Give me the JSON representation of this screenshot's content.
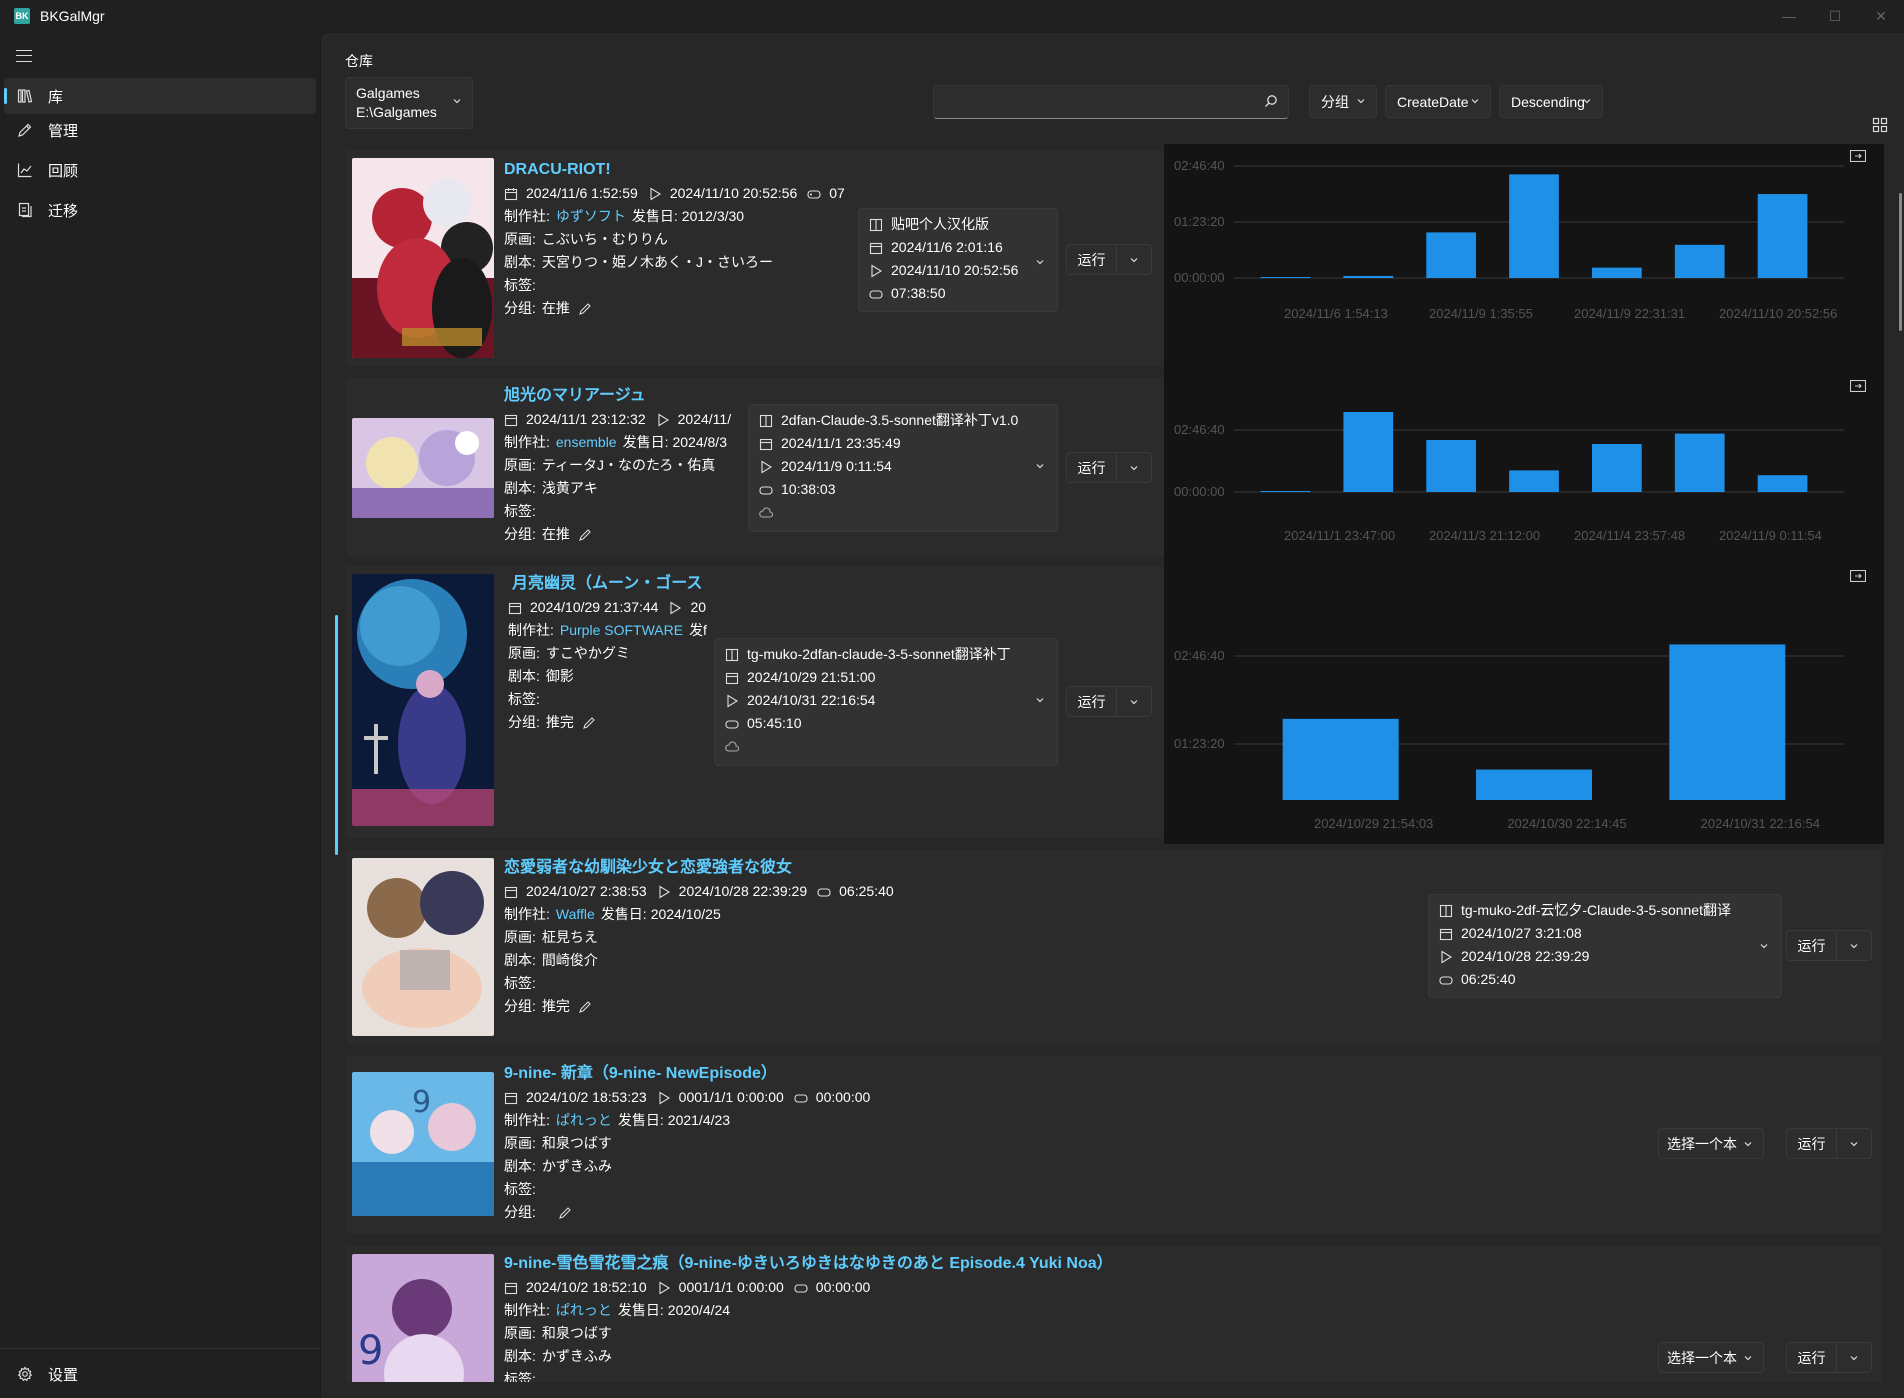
{
  "window": {
    "title": "BKGalMgr",
    "icon_label": "BK"
  },
  "sidebar": {
    "items": [
      {
        "label": "库",
        "icon": "library-icon"
      },
      {
        "label": "管理",
        "icon": "edit-icon"
      },
      {
        "label": "回顾",
        "icon": "chart-icon"
      },
      {
        "label": "迁移",
        "icon": "migrate-icon"
      }
    ],
    "settings_label": "设置"
  },
  "header": {
    "page_title": "仓库",
    "repo_name": "Galgames",
    "repo_path": "E:\\Galgames",
    "search_placeholder": "",
    "group_combo": "分组",
    "sort_combo": "CreateDate",
    "order_combo": "Descending"
  },
  "colors": {
    "accent": "#60cdff",
    "bar": "#1e90e8",
    "card": "#2b2b2b",
    "chart_bg": "#141414"
  },
  "games": [
    {
      "title": "DRACU-RIOT!",
      "created": "2024/11/6 1:52:59",
      "last_played": "2024/11/10 20:52:56",
      "playtime": "07",
      "maker_label": "制作社:",
      "maker": "ゆずソフト",
      "release_label": "发售日:",
      "release": "2012/3/30",
      "artist_label": "原画:",
      "artist": "こぶいち・むりりん",
      "writer_label": "剧本:",
      "writer": "天宮りつ・姫ノ木あく・J・さいろー",
      "tags_label": "标签:",
      "group_label": "分组:",
      "group": "在推",
      "patch": {
        "name": "贴吧个人汉化版",
        "created": "2024/11/6 2:01:16",
        "last_played": "2024/11/10 20:52:56",
        "playtime": "07:38:50"
      },
      "run_label": "运行"
    },
    {
      "title": "旭光のマリアージュ",
      "created": "2024/11/1 23:12:32",
      "last_played": "2024/11/",
      "maker_label": "制作社:",
      "maker": "ensemble",
      "release_label": "发售日:",
      "release": "2024/8/3",
      "artist_label": "原画:",
      "artist": "ティータJ・なのたろ・佑真",
      "writer_label": "剧本:",
      "writer": "浅黄アキ",
      "tags_label": "标签:",
      "group_label": "分组:",
      "group": "在推",
      "patch": {
        "name": "2dfan-Claude-3.5-sonnet翻译补丁v1.0",
        "created": "2024/11/1 23:35:49",
        "last_played": "2024/11/9 0:11:54",
        "playtime": "10:38:03"
      },
      "run_label": "运行"
    },
    {
      "title": "月亮幽灵（ムーン・ゴース",
      "created": "2024/10/29 21:37:44",
      "last_played": "20",
      "maker_label": "制作社:",
      "maker": "Purple SOFTWARE",
      "release_label": "发f",
      "artist_label": "原画:",
      "artist": "すこやかグミ",
      "writer_label": "剧本:",
      "writer": "御影",
      "tags_label": "标签:",
      "group_label": "分组:",
      "group": "推完",
      "patch": {
        "name": "tg-muko-2dfan-claude-3-5-sonnet翻译补丁",
        "created": "2024/10/29 21:51:00",
        "last_played": "2024/10/31 22:16:54",
        "playtime": "05:45:10"
      },
      "run_label": "运行"
    },
    {
      "title": "恋愛弱者な幼馴染少女と恋愛強者な彼女",
      "created": "2024/10/27 2:38:53",
      "last_played": "2024/10/28 22:39:29",
      "playtime": "06:25:40",
      "maker_label": "制作社:",
      "maker": "Waffle",
      "release_label": "发售日:",
      "release": "2024/10/25",
      "artist_label": "原画:",
      "artist": "柾見ちえ",
      "writer_label": "剧本:",
      "writer": "間崎俊介",
      "tags_label": "标签:",
      "group_label": "分组:",
      "group": "推完",
      "patch": {
        "name": "tg-muko-2df-云忆夕-Claude-3-5-sonnet翻译",
        "created": "2024/10/27 3:21:08",
        "last_played": "2024/10/28 22:39:29",
        "playtime": "06:25:40"
      },
      "run_label": "运行"
    },
    {
      "title": "9-nine- 新章（9-nine- NewEpisode）",
      "created": "2024/10/2 18:53:23",
      "last_played": "0001/1/1 0:00:00",
      "playtime": "00:00:00",
      "maker_label": "制作社:",
      "maker": "ぱれっと",
      "release_label": "发售日:",
      "release": "2021/4/23",
      "artist_label": "原画:",
      "artist": "和泉つばす",
      "writer_label": "剧本:",
      "writer": "かずきふみ",
      "tags_label": "标签:",
      "group_label": "分组:",
      "group": "",
      "select_label": "选择一个本",
      "run_label": "运行"
    },
    {
      "title": "9-nine-雪色雪花雪之痕（9-nine-ゆきいろゆきはなゆきのあと Episode.4 Yuki Noa）",
      "created": "2024/10/2 18:52:10",
      "last_played": "0001/1/1 0:00:00",
      "playtime": "00:00:00",
      "maker_label": "制作社:",
      "maker": "ぱれっと",
      "release_label": "发售日:",
      "release": "2020/4/24",
      "artist_label": "原画:",
      "artist": "和泉つばす",
      "writer_label": "剧本:",
      "writer": "かずきふみ",
      "tags_label": "标签:",
      "select_label": "选择一个本",
      "run_label": "运行"
    }
  ],
  "chart_data": [
    {
      "type": "bar",
      "categories": [
        "2024/11/6 1:54:13",
        "2024/11/9 1:35:55",
        "2024/11/9 22:31:31",
        "2024/11/10 20:52:56"
      ],
      "y_ticks": [
        "00:00:00",
        "01:23:20",
        "02:46:40"
      ],
      "values_seconds": [
        60,
        200,
        4400,
        10000,
        1000,
        3200,
        8100
      ],
      "ylim": [
        0,
        11000
      ]
    },
    {
      "type": "bar",
      "categories": [
        "2024/11/1 23:47:00",
        "2024/11/3 21:12:00",
        "2024/11/4 23:57:48",
        "2024/11/9 0:11:54"
      ],
      "y_ticks": [
        "00:00:00",
        "02:46:40"
      ],
      "values_seconds": [
        50,
        10000,
        6500,
        2700,
        6000,
        7300,
        2100
      ],
      "ylim": [
        0,
        12500
      ]
    },
    {
      "type": "bar",
      "categories": [
        "2024/10/29 21:54:03",
        "2024/10/30 22:14:45",
        "2024/10/31 22:16:54"
      ],
      "y_ticks": [
        "01:23:20",
        "02:46:40"
      ],
      "values_seconds": [
        4800,
        1800,
        9200
      ],
      "ylim": [
        0,
        11000
      ]
    }
  ]
}
